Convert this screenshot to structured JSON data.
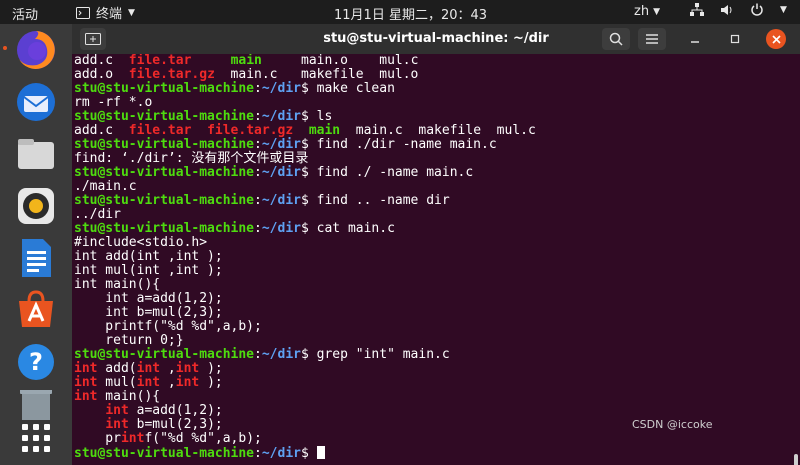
{
  "topbar": {
    "activities": "活动",
    "app_name": "终端",
    "clock": "11月1日 星期二，20：43",
    "lang": "zh"
  },
  "window": {
    "title": "stu@stu-virtual-machine: ~/dir"
  },
  "terminal": {
    "lines": [
      [
        {
          "t": "add.c  ",
          "c": "w"
        },
        {
          "t": "file.tar",
          "c": "r"
        },
        {
          "t": "     ",
          "c": "w"
        },
        {
          "t": "main",
          "c": "g"
        },
        {
          "t": "     main.o    mul.c",
          "c": "w"
        }
      ],
      [
        {
          "t": "add.o  ",
          "c": "w"
        },
        {
          "t": "file.tar.gz",
          "c": "r"
        },
        {
          "t": "  main.c   makefile  mul.o",
          "c": "w"
        }
      ],
      [
        {
          "t": "stu@stu-virtual-machine",
          "c": "p"
        },
        {
          "t": ":",
          "c": "w"
        },
        {
          "t": "~/dir",
          "c": "d"
        },
        {
          "t": "$ make clean",
          "c": "w"
        }
      ],
      [
        {
          "t": "rm -rf *.o",
          "c": "w"
        }
      ],
      [
        {
          "t": "stu@stu-virtual-machine",
          "c": "p"
        },
        {
          "t": ":",
          "c": "w"
        },
        {
          "t": "~/dir",
          "c": "d"
        },
        {
          "t": "$ ls",
          "c": "w"
        }
      ],
      [
        {
          "t": "add.c  ",
          "c": "w"
        },
        {
          "t": "file.tar",
          "c": "r"
        },
        {
          "t": "  ",
          "c": "w"
        },
        {
          "t": "file.tar.gz",
          "c": "r"
        },
        {
          "t": "  ",
          "c": "w"
        },
        {
          "t": "main",
          "c": "g"
        },
        {
          "t": "  main.c  makefile  mul.c",
          "c": "w"
        }
      ],
      [
        {
          "t": "stu@stu-virtual-machine",
          "c": "p"
        },
        {
          "t": ":",
          "c": "w"
        },
        {
          "t": "~/dir",
          "c": "d"
        },
        {
          "t": "$ find ./dir -name main.c",
          "c": "w"
        }
      ],
      [
        {
          "t": "find: ‘./dir’: 没有那个文件或目录",
          "c": "w"
        }
      ],
      [
        {
          "t": "stu@stu-virtual-machine",
          "c": "p"
        },
        {
          "t": ":",
          "c": "w"
        },
        {
          "t": "~/dir",
          "c": "d"
        },
        {
          "t": "$ find ./ -name main.c",
          "c": "w"
        }
      ],
      [
        {
          "t": "./main.c",
          "c": "w"
        }
      ],
      [
        {
          "t": "stu@stu-virtual-machine",
          "c": "p"
        },
        {
          "t": ":",
          "c": "w"
        },
        {
          "t": "~/dir",
          "c": "d"
        },
        {
          "t": "$ find .. -name dir",
          "c": "w"
        }
      ],
      [
        {
          "t": "../dir",
          "c": "w"
        }
      ],
      [
        {
          "t": "stu@stu-virtual-machine",
          "c": "p"
        },
        {
          "t": ":",
          "c": "w"
        },
        {
          "t": "~/dir",
          "c": "d"
        },
        {
          "t": "$ cat main.c",
          "c": "w"
        }
      ],
      [
        {
          "t": "#include<stdio.h>",
          "c": "w"
        }
      ],
      [
        {
          "t": "int add(int ,int );",
          "c": "w"
        }
      ],
      [
        {
          "t": "int mul(int ,int );",
          "c": "w"
        }
      ],
      [
        {
          "t": "int main(){",
          "c": "w"
        }
      ],
      [
        {
          "t": "    int a=add(1,2);",
          "c": "w"
        }
      ],
      [
        {
          "t": "    int b=mul(2,3);",
          "c": "w"
        }
      ],
      [
        {
          "t": "    printf(\"%d %d\",a,b);",
          "c": "w"
        }
      ],
      [
        {
          "t": "    return 0;}",
          "c": "w"
        }
      ],
      [
        {
          "t": "stu@stu-virtual-machine",
          "c": "p"
        },
        {
          "t": ":",
          "c": "w"
        },
        {
          "t": "~/dir",
          "c": "d"
        },
        {
          "t": "$ grep \"int\" main.c",
          "c": "w"
        }
      ],
      [
        {
          "t": "int",
          "c": "r"
        },
        {
          "t": " add(",
          "c": "w"
        },
        {
          "t": "int",
          "c": "r"
        },
        {
          "t": " ,",
          "c": "w"
        },
        {
          "t": "int",
          "c": "r"
        },
        {
          "t": " );",
          "c": "w"
        }
      ],
      [
        {
          "t": "int",
          "c": "r"
        },
        {
          "t": " mul(",
          "c": "w"
        },
        {
          "t": "int",
          "c": "r"
        },
        {
          "t": " ,",
          "c": "w"
        },
        {
          "t": "int",
          "c": "r"
        },
        {
          "t": " );",
          "c": "w"
        }
      ],
      [
        {
          "t": "int",
          "c": "r"
        },
        {
          "t": " main(){",
          "c": "w"
        }
      ],
      [
        {
          "t": "    ",
          "c": "w"
        },
        {
          "t": "int",
          "c": "r"
        },
        {
          "t": " a=add(1,2);",
          "c": "w"
        }
      ],
      [
        {
          "t": "    ",
          "c": "w"
        },
        {
          "t": "int",
          "c": "r"
        },
        {
          "t": " b=mul(2,3);",
          "c": "w"
        }
      ],
      [
        {
          "t": "    pr",
          "c": "w"
        },
        {
          "t": "int",
          "c": "r"
        },
        {
          "t": "f(\"%d %d\",a,b);",
          "c": "w"
        }
      ],
      [
        {
          "t": "stu@stu-virtual-machine",
          "c": "p"
        },
        {
          "t": ":",
          "c": "w"
        },
        {
          "t": "~/dir",
          "c": "d"
        },
        {
          "t": "$ ",
          "c": "w"
        }
      ]
    ]
  },
  "watermark": "CSDN @iccoke",
  "dock": {
    "items": [
      "firefox-icon",
      "thunderbird-icon",
      "files-icon",
      "rhythmbox-icon",
      "writer-icon",
      "software-icon",
      "help-icon",
      "trash-icon",
      "apps-grid-icon"
    ]
  },
  "colors": {
    "prompt": "#4edc0f",
    "path": "#5ea1f2",
    "archive": "#ef2929",
    "background": "#300a24"
  }
}
